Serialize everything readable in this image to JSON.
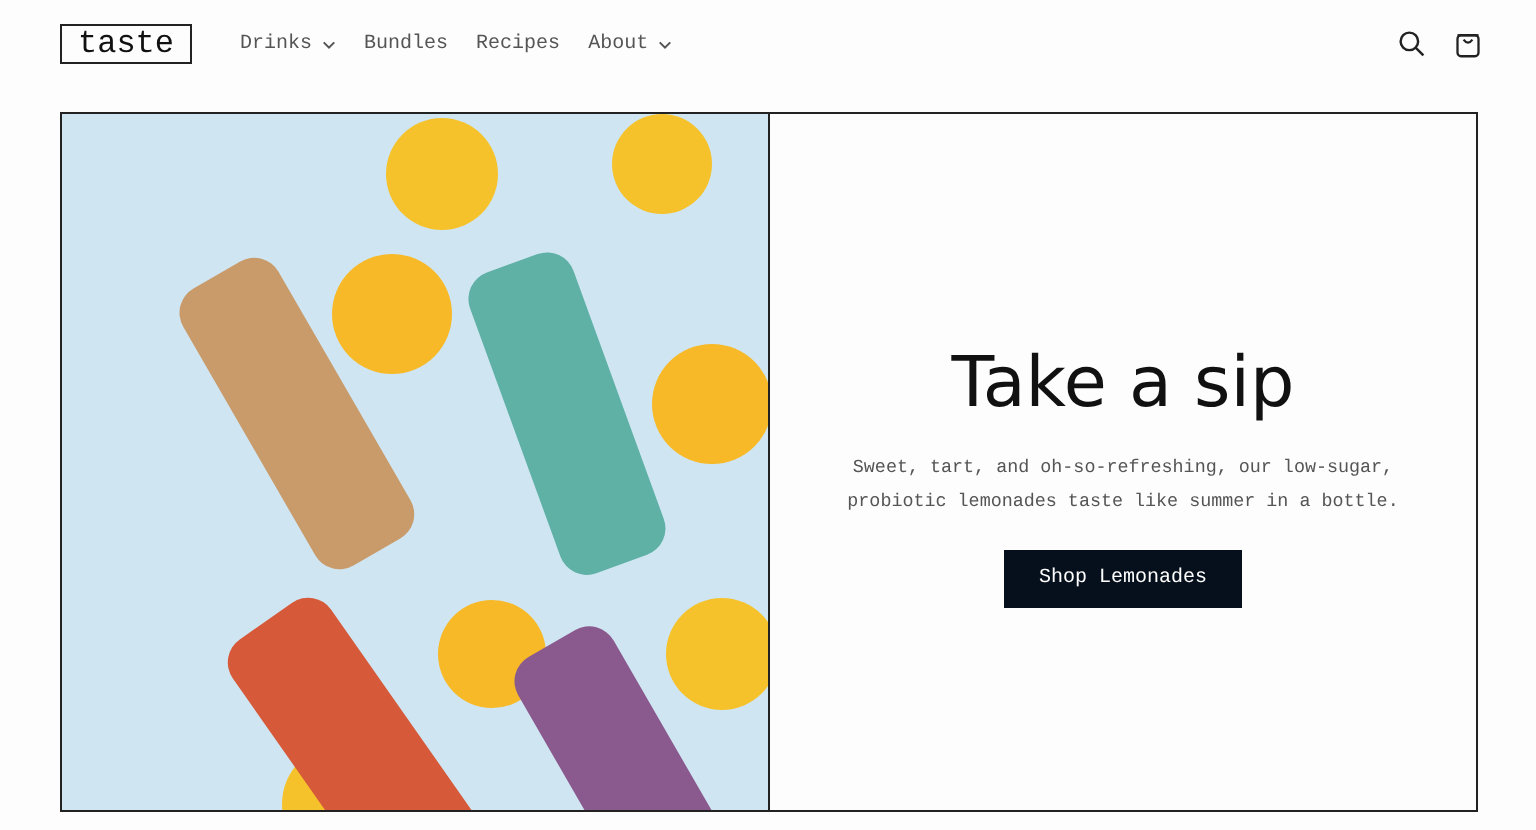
{
  "header": {
    "logo": "taste",
    "nav": [
      {
        "label": "Drinks",
        "dropdown": true
      },
      {
        "label": "Bundles",
        "dropdown": false
      },
      {
        "label": "Recipes",
        "dropdown": false
      },
      {
        "label": "About",
        "dropdown": true
      }
    ]
  },
  "hero": {
    "title": "Take a sip",
    "text": "Sweet, tart, and oh-so-refreshing, our low-sugar, probiotic lemonades taste like summer in a bottle.",
    "button": "Shop Lemonades"
  }
}
